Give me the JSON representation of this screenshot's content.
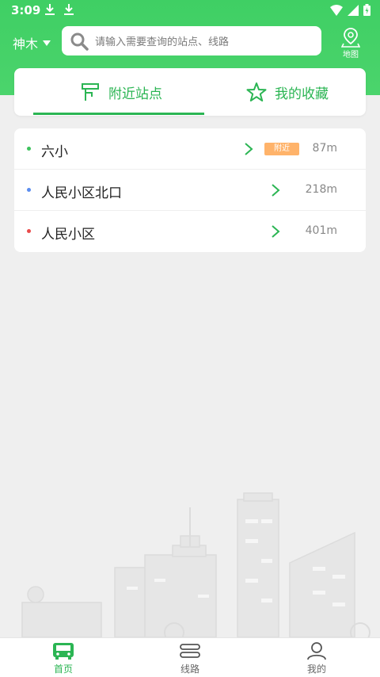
{
  "status_bar": {
    "time": "3:09"
  },
  "header": {
    "city": "神木",
    "search_placeholder": "请输入需要查询的站点、线路",
    "map_label": "地图"
  },
  "tabs": [
    {
      "label": "附近站点",
      "icon": "bus-stop-icon",
      "active": true
    },
    {
      "label": "我的收藏",
      "icon": "star-icon",
      "active": false
    }
  ],
  "stations": [
    {
      "name": "六小",
      "badge": "附近",
      "distance": "87m",
      "dot_color": "#3ec35e"
    },
    {
      "name": "人民小区北口",
      "badge": "",
      "distance": "218m",
      "dot_color": "#5b8def"
    },
    {
      "name": "人民小区",
      "badge": "",
      "distance": "401m",
      "dot_color": "#e94b4b"
    }
  ],
  "bottom_nav": [
    {
      "label": "首页",
      "icon": "bus-icon",
      "active": true
    },
    {
      "label": "线路",
      "icon": "route-icon",
      "active": false
    },
    {
      "label": "我的",
      "icon": "user-icon",
      "active": false
    }
  ],
  "colors": {
    "accent": "#2bb553",
    "header": "#3fcf64",
    "badge": "#ffb36a"
  }
}
